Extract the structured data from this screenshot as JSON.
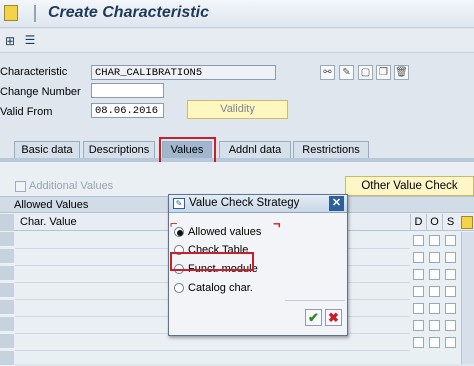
{
  "window": {
    "title": "Create Characteristic"
  },
  "toolbar": {
    "icons": [
      "hierarchy-icon",
      "structure-icon"
    ]
  },
  "header": {
    "characteristic_label": "Characteristic",
    "characteristic_value": "CHAR_CALIBRATION5",
    "change_number_label": "Change Number",
    "change_number_value": "",
    "valid_from_label": "Valid From",
    "valid_from_value": "08.06.2016",
    "validity_button": "Validity"
  },
  "tabs": [
    "Basic data",
    "Descriptions",
    "Values",
    "Addnl data",
    "Restrictions"
  ],
  "active_tab": "Values",
  "values_tab": {
    "additional_values_label": "Additional Values",
    "other_value_check_button": "Other Value Check",
    "allowed_values_header": "Allowed Values",
    "col_char_value": "Char. Value",
    "col_d": "D",
    "col_o": "O",
    "col_s": "S"
  },
  "dialog": {
    "title": "Value Check Strategy",
    "options": [
      "Allowed values",
      "Check Table",
      "Funct. module",
      "Catalog char."
    ],
    "selected": "Allowed values"
  },
  "colors": {
    "highlight": "#c8202a",
    "accent": "#2c5f9c",
    "yellow": "#fff7bf"
  }
}
